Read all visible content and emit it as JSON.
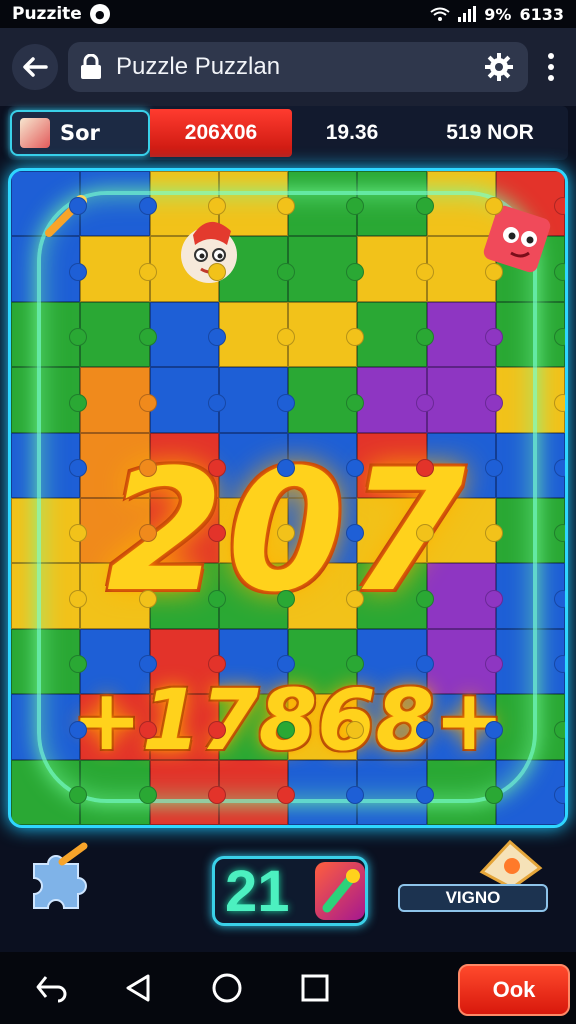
{
  "status_bar": {
    "app_name": "Puzzite",
    "battery": "9%",
    "time": "6133"
  },
  "app_bar": {
    "title": "Puzzle Puzzlan",
    "icons": [
      "back-arrow-icon",
      "lock-icon",
      "gear-icon",
      "more-vert-icon"
    ]
  },
  "score_bar": {
    "player_name": "Sor",
    "score_main": "206X06",
    "score_mid": "19.36",
    "score_right": "519 NOR"
  },
  "board": {
    "big_number": "207",
    "bonus_number": "+17868+",
    "tile_colors": [
      "#1e5fd6",
      "#2aa834",
      "#f2c21a",
      "#e3332a",
      "#8e36c2",
      "#f08a1c",
      "#1e5fd6",
      "#2aa834"
    ]
  },
  "tools": {
    "counter_value": "21",
    "hint_label": "VIGNO"
  },
  "nav": {
    "ok_label": "Ook"
  },
  "colors": {
    "accent_cyan": "#2fd7ff",
    "score_red": "#e3241a",
    "number_gold": "#ffd21c",
    "glow_green": "#78ffa0"
  }
}
